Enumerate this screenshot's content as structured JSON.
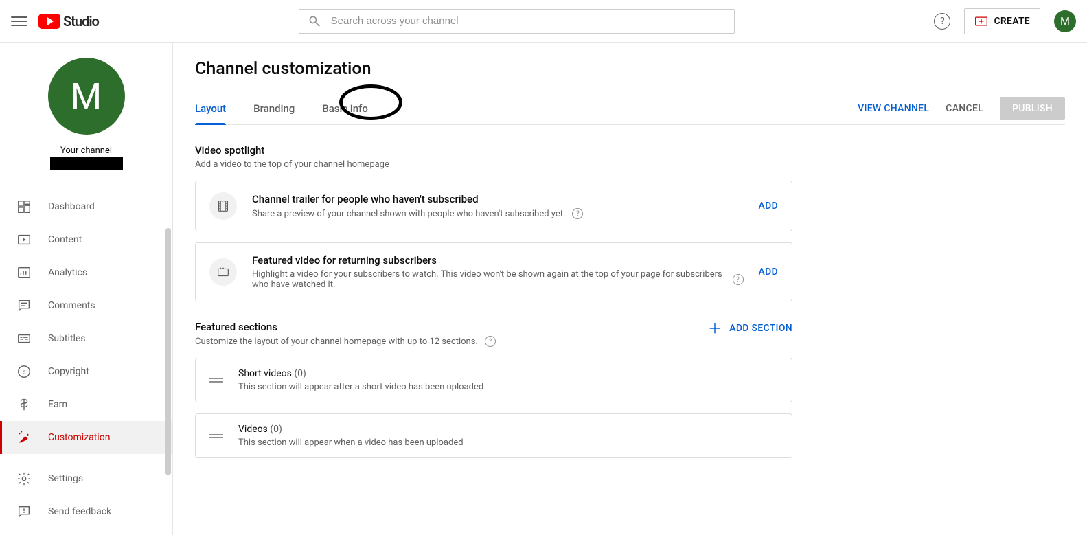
{
  "header": {
    "logo_text": "Studio",
    "search_placeholder": "Search across your channel",
    "create_label": "CREATE",
    "avatar_letter": "M"
  },
  "sidebar": {
    "avatar_letter": "M",
    "channel_label": "Your channel",
    "items": [
      {
        "label": "Dashboard"
      },
      {
        "label": "Content"
      },
      {
        "label": "Analytics"
      },
      {
        "label": "Comments"
      },
      {
        "label": "Subtitles"
      },
      {
        "label": "Copyright"
      },
      {
        "label": "Earn"
      },
      {
        "label": "Customization"
      }
    ],
    "bottom": [
      {
        "label": "Settings"
      },
      {
        "label": "Send feedback"
      }
    ]
  },
  "main": {
    "title": "Channel customization",
    "tabs": [
      {
        "label": "Layout"
      },
      {
        "label": "Branding"
      },
      {
        "label": "Basic info"
      }
    ],
    "actions": {
      "view": "VIEW CHANNEL",
      "cancel": "CANCEL",
      "publish": "PUBLISH"
    },
    "spotlight": {
      "title": "Video spotlight",
      "sub": "Add a video to the top of your channel homepage",
      "trailer": {
        "title": "Channel trailer for people who haven't subscribed",
        "sub": "Share a preview of your channel shown with people who haven't subscribed yet.",
        "add": "ADD"
      },
      "featured_video": {
        "title": "Featured video for returning subscribers",
        "sub": "Highlight a video for your subscribers to watch. This video won't be shown again at the top of your page for subscribers who have watched it.",
        "add": "ADD"
      }
    },
    "featured_sections": {
      "title": "Featured sections",
      "sub": "Customize the layout of your channel homepage with up to 12 sections.",
      "add_section": "ADD SECTION",
      "rows": [
        {
          "title": "Short videos",
          "count": "(0)",
          "sub": "This section will appear after a short video has been uploaded"
        },
        {
          "title": "Videos",
          "count": "(0)",
          "sub": "This section will appear when a video has been uploaded"
        }
      ]
    }
  }
}
